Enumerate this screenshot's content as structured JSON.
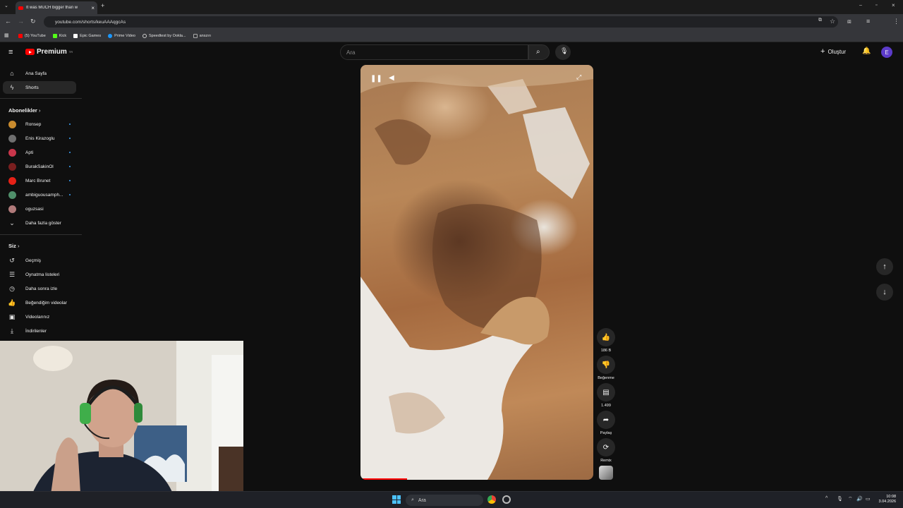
{
  "browser": {
    "tab_title": "It was MUCH bigger than w",
    "url": "youtube.com/shorts/keuAAAqgcAs",
    "bookmarks": [
      "(5) YouTube",
      "Kick",
      "Epic Games",
      "Prime Video",
      "Speedtest by Ookla...",
      "anszırı"
    ],
    "bookmark_colors": [
      "#ff0000",
      "#53fc18",
      "#ffffff",
      "#1a98ff",
      "#cccccc",
      "#888888"
    ]
  },
  "youtube": {
    "logo_text": "Premium",
    "logo_sup": "TR",
    "search_placeholder": "Ara",
    "create_label": "Oluştur",
    "avatar_letter": "E"
  },
  "sidebar": {
    "main_items": [
      {
        "label": "Ana Sayfa",
        "icon": "home-icon"
      },
      {
        "label": "Shorts",
        "icon": "shorts-icon",
        "active": true
      }
    ],
    "subs_header": "Abonelikler",
    "subscriptions": [
      {
        "label": "Ronsep",
        "color": "#c98b2e"
      },
      {
        "label": "Enis Kirazoglu",
        "color": "#6f6f6f"
      },
      {
        "label": "Apti",
        "color": "#c9364b"
      },
      {
        "label": "BurakSakinOl",
        "color": "#7a1f1f"
      },
      {
        "label": "Marc Brunet",
        "color": "#e62117"
      },
      {
        "label": "ambiguousamph...",
        "color": "#4f8f6a"
      },
      {
        "label": "oguzsasi",
        "color": "#b07a7a"
      }
    ],
    "show_more": "Daha fazla göster",
    "you_header": "Siz",
    "you_items": [
      {
        "label": "Geçmiş",
        "icon": "history-icon"
      },
      {
        "label": "Oynatma listeleri",
        "icon": "playlists-icon"
      },
      {
        "label": "Daha sonra izle",
        "icon": "watch-later-icon"
      },
      {
        "label": "Beğendiğim videolar",
        "icon": "liked-icon"
      },
      {
        "label": "Videolarınız",
        "icon": "your-videos-icon"
      },
      {
        "label": "İndirilenler",
        "icon": "downloads-icon"
      }
    ]
  },
  "actions": {
    "likes": "186 B",
    "dislike": "Beğenme",
    "comments": "1.499",
    "share": "Paylaş",
    "remix": "Remix"
  },
  "video": {
    "progress": 0.2
  },
  "taskbar": {
    "search_placeholder": "Ara",
    "time": "10:08",
    "date": "3.04.2026"
  }
}
